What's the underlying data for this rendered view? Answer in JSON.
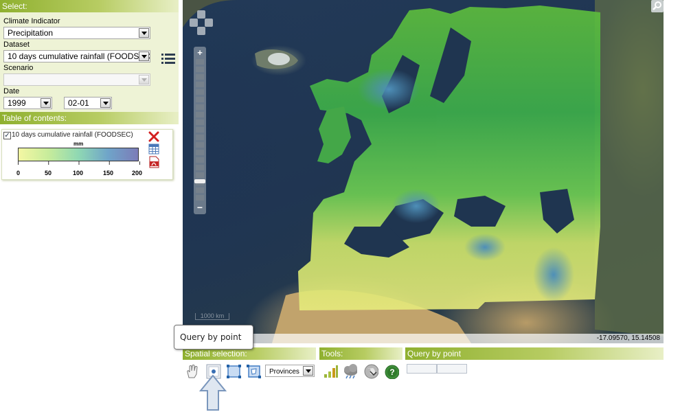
{
  "select": {
    "header": "Select:",
    "climate_indicator_label": "Climate Indicator",
    "climate_indicator_value": "Precipitation",
    "dataset_label": "Dataset",
    "dataset_value": "10 days cumulative rainfall (FOODSEC)",
    "scenario_label": "Scenario",
    "scenario_value": "",
    "date_label": "Date",
    "year_value": "1999",
    "day_value": "02-01"
  },
  "toc": {
    "header": "Table of contents:",
    "layer_name": "10 days cumulative rainfall (FOODSEC)",
    "legend_unit": "mm",
    "legend_ticks": [
      "0",
      "50",
      "100",
      "150",
      "200"
    ],
    "legend_colors": [
      "#f4f7a3",
      "#c7ec9b",
      "#8fd8b3",
      "#6fa4c9",
      "#7c7cb8"
    ]
  },
  "map": {
    "coordinates": "-17.09570, 15.14508",
    "scale_label": "1000 km",
    "icons": [
      "pan-zoom-icon",
      "zoom-in-icon",
      "zoom-out-icon",
      "magnify-icon"
    ]
  },
  "toolbar": {
    "spatial_header": "Spatial selection:",
    "tools_header": "Tools:",
    "query_header": "Query by point",
    "tooltip": "Query by point",
    "region_select_value": "Provinces"
  },
  "colors": {
    "accent_green": "#8fb02f",
    "panel_bg": "#eef3d6"
  }
}
